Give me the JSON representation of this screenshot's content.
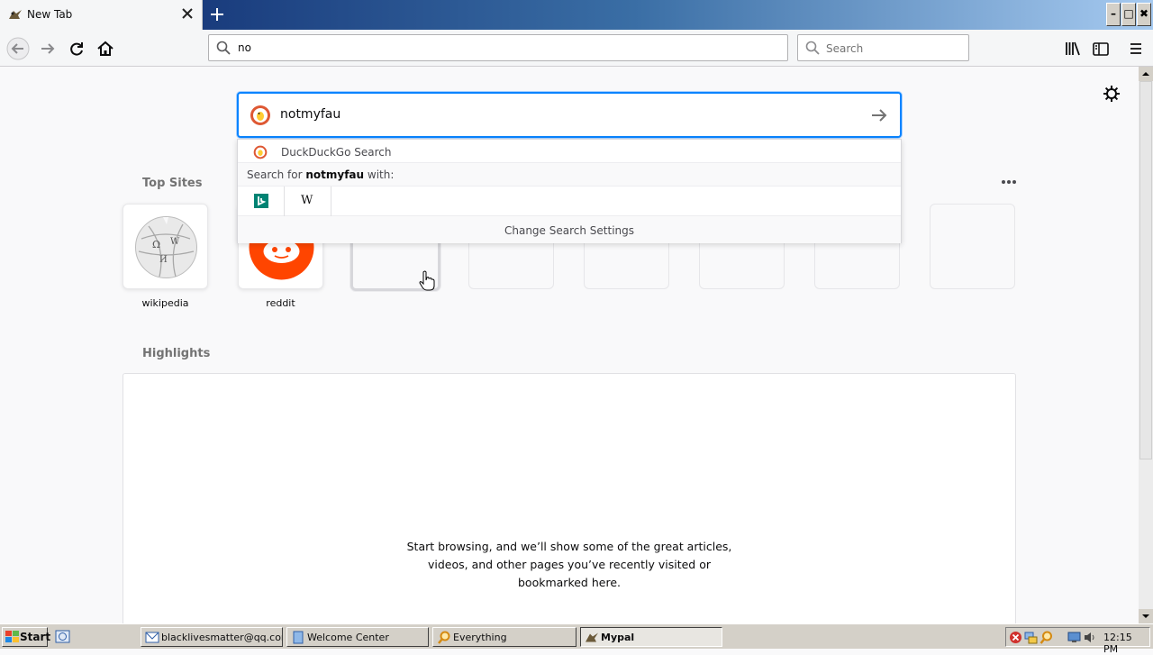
{
  "tab": {
    "title": "New Tab"
  },
  "window_buttons": {
    "minimize": "–",
    "restore": "□",
    "close": "✖"
  },
  "urlbar": {
    "value": "no"
  },
  "searchbar": {
    "placeholder": "Search"
  },
  "newtab_search": {
    "value": "notmyfau",
    "engine_row": "DuckDuckGo Search",
    "search_for_prefix": "Search for ",
    "search_for_term": "notmyfau",
    "search_for_suffix": " with:",
    "engines": [
      "bing",
      "W"
    ],
    "change_settings": "Change Search Settings"
  },
  "top_sites": {
    "title": "Top Sites",
    "tiles": [
      {
        "label": "wikipedia"
      },
      {
        "label": "reddit"
      }
    ]
  },
  "highlights": {
    "title": "Highlights",
    "message_lines": [
      "Start browsing, and we’ll show some of the great articles,",
      "videos, and other pages you’ve recently visited or",
      "bookmarked here."
    ]
  },
  "taskbar": {
    "start": "Start",
    "tasks": [
      {
        "label": "blacklivesmatter@qq.com"
      },
      {
        "label": "Welcome Center"
      },
      {
        "label": "Everything"
      },
      {
        "label": "Mypal"
      }
    ],
    "clock": "12:15 PM"
  },
  "colors": {
    "accent": "#0a84ff",
    "reddit": "#ff4500",
    "duckduckgo": "#de5833",
    "bing": "#008373"
  }
}
